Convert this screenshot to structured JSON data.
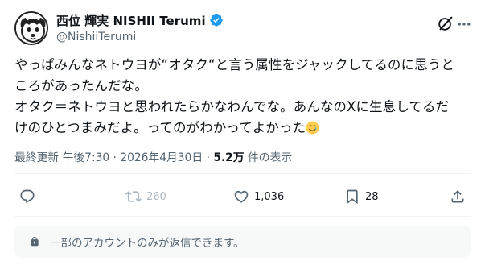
{
  "author": {
    "display_name": "西位 輝実 NISHII Terumi",
    "handle": "@NishiiTerumi",
    "verified_color": "#1d9bf0"
  },
  "tweet": {
    "text_line1": "やっぱみんなネトウヨが“オタク“と言う属性をジャックしてるのに思うと",
    "text_line2": "ころがあったんだな。",
    "text_line3": "オタク＝ネトウヨと思われたらかなわんでな。あんなのXに生息してるだ",
    "text_line4": "けのひとつまみだよ。ってのがわかってよかった",
    "emoji": "tear-smile-emoji"
  },
  "meta": {
    "edited_label": "最終更新",
    "time": "午後7:30",
    "separator": "·",
    "date": "2026年4月30日",
    "views_count": "5.2万",
    "views_label": "件の表示"
  },
  "actions": {
    "reply_count": "",
    "retweet_count": "260",
    "like_count": "1,036",
    "bookmark_count": "28"
  },
  "reply_restriction": {
    "text": "一部のアカウントのみが返信できます。"
  },
  "icons": {
    "grok": "grok-icon",
    "more": "more-icon",
    "reply": "reply-icon",
    "retweet": "retweet-icon",
    "like": "heart-icon",
    "bookmark": "bookmark-icon",
    "share": "share-icon",
    "lock": "lock-icon"
  }
}
